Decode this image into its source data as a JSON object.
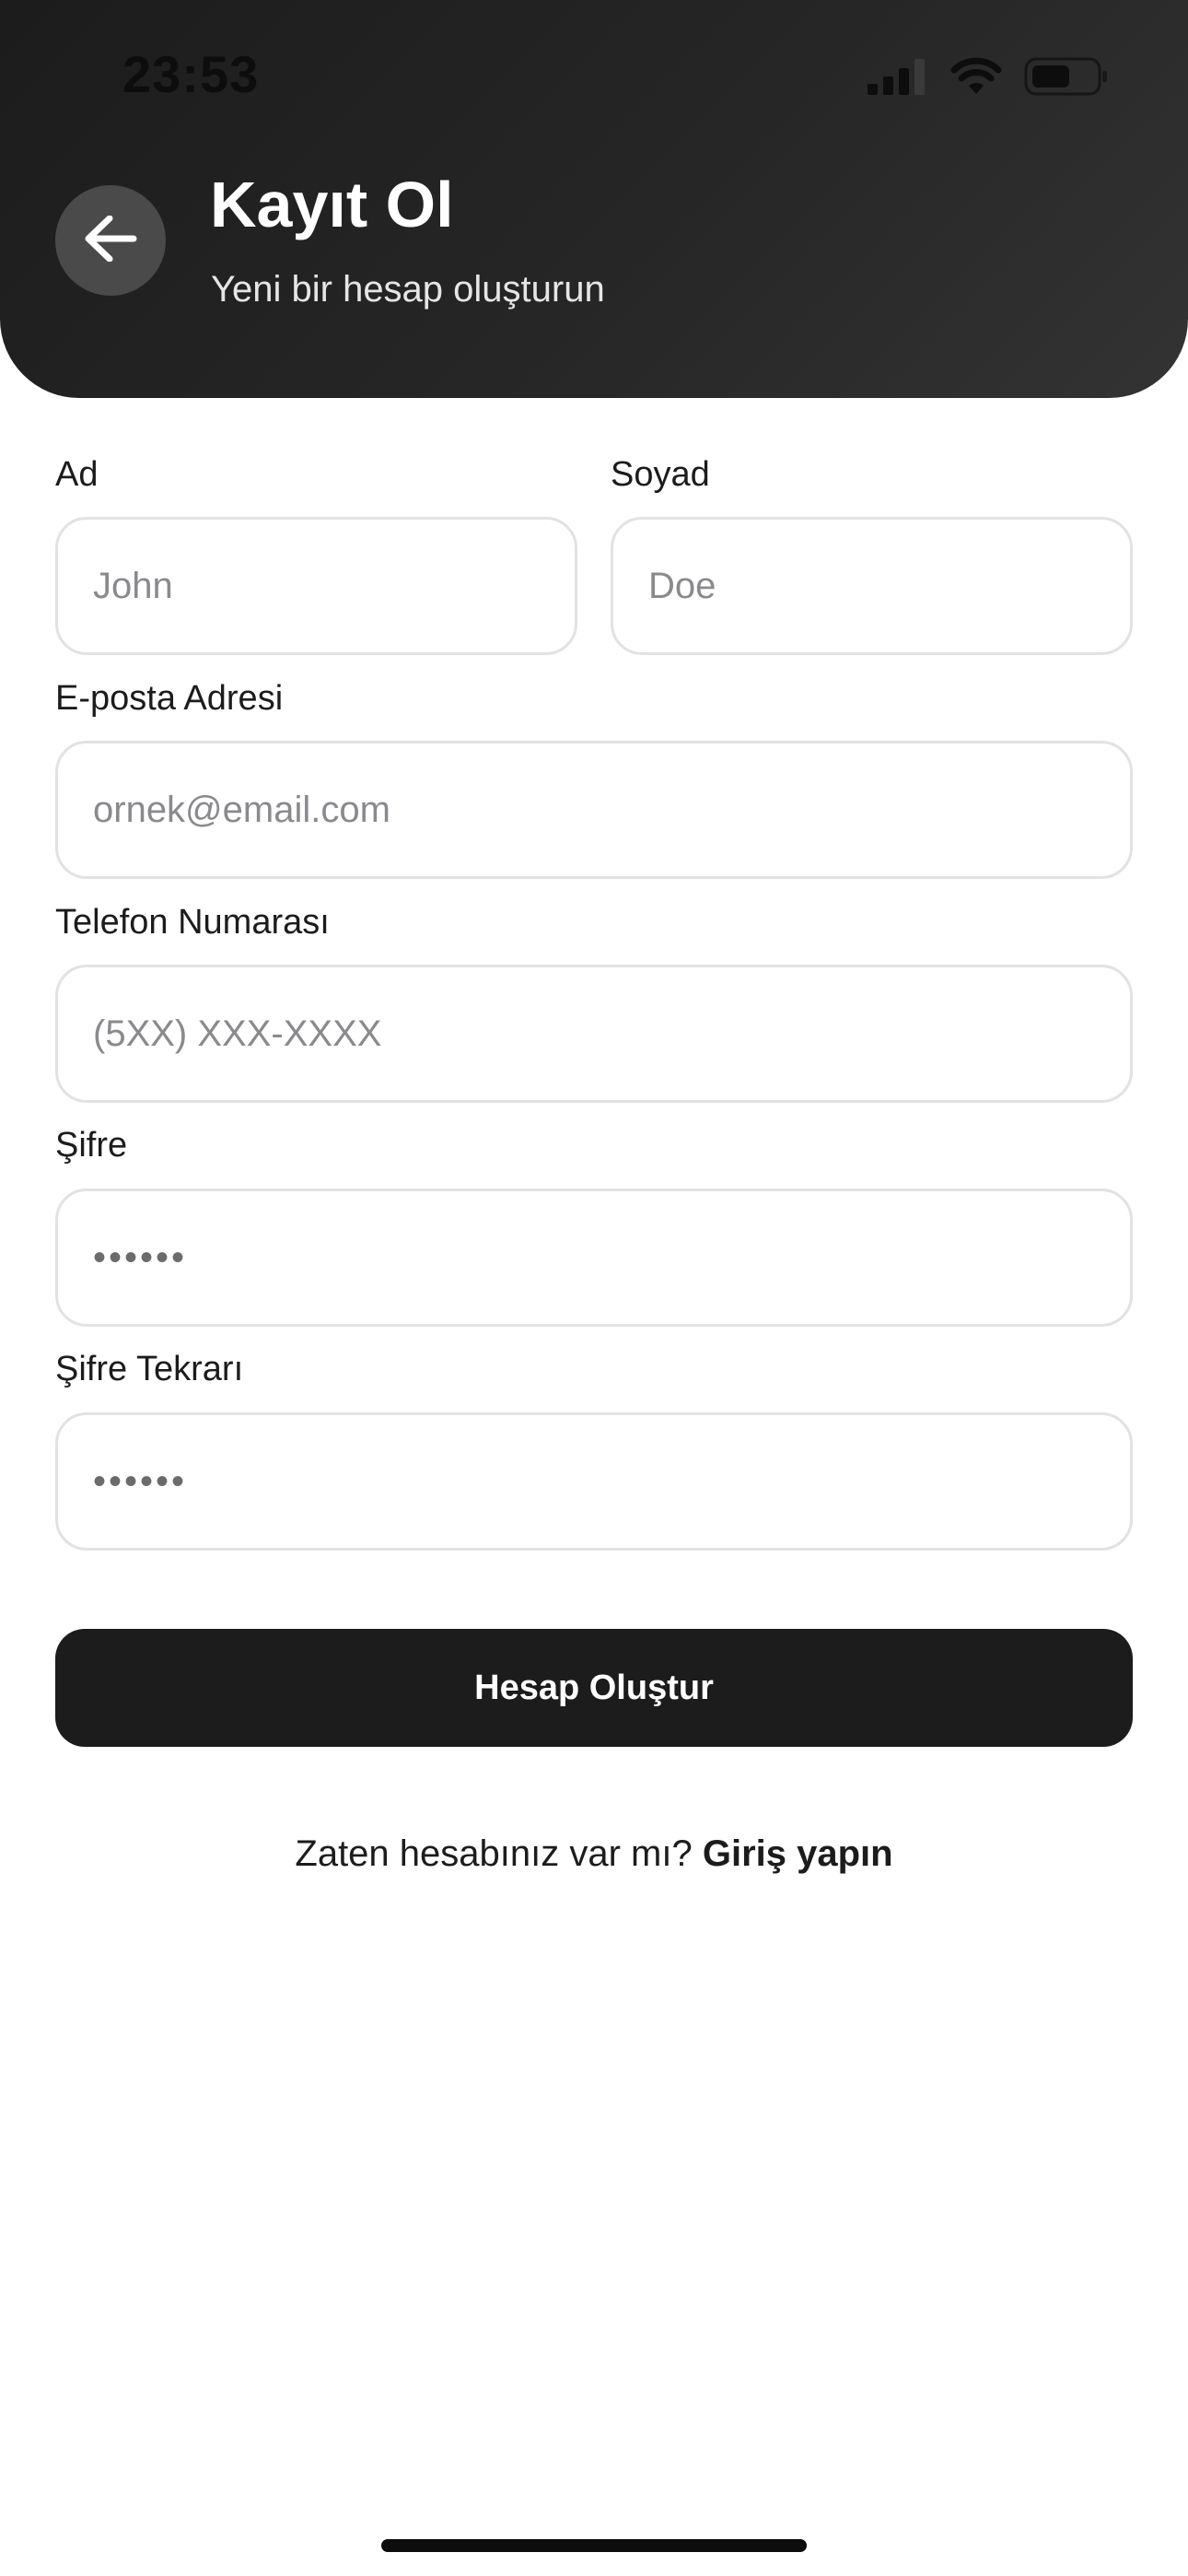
{
  "status_bar": {
    "time": "23:53",
    "icons": [
      "cellular-signal-icon",
      "wifi-icon",
      "battery-icon"
    ]
  },
  "header": {
    "back_icon": "arrow-left-icon",
    "title": "Kayıt Ol",
    "subtitle": "Yeni bir hesap oluşturun"
  },
  "form": {
    "first_name": {
      "label": "Ad",
      "placeholder": "John",
      "value": ""
    },
    "last_name": {
      "label": "Soyad",
      "placeholder": "Doe",
      "value": ""
    },
    "email": {
      "label": "E-posta Adresi",
      "placeholder": "ornek@email.com",
      "value": ""
    },
    "phone": {
      "label": "Telefon Numarası",
      "placeholder": "(5XX) XXX-XXXX",
      "value": ""
    },
    "password": {
      "label": "Şifre",
      "masked_value": "••••••"
    },
    "password_confirm": {
      "label": "Şifre Tekrarı",
      "masked_value": "••••••"
    },
    "submit_label": "Hesap Oluştur"
  },
  "footer": {
    "prompt": "Zaten hesabınız var mı?",
    "login_link": "Giriş yapın"
  },
  "colors": {
    "header_bg": "#262626",
    "back_button_bg": "#4a4a4a",
    "button_bg": "#1c1c1c",
    "field_border": "#e2e2e2",
    "placeholder": "#8a8a8e"
  }
}
